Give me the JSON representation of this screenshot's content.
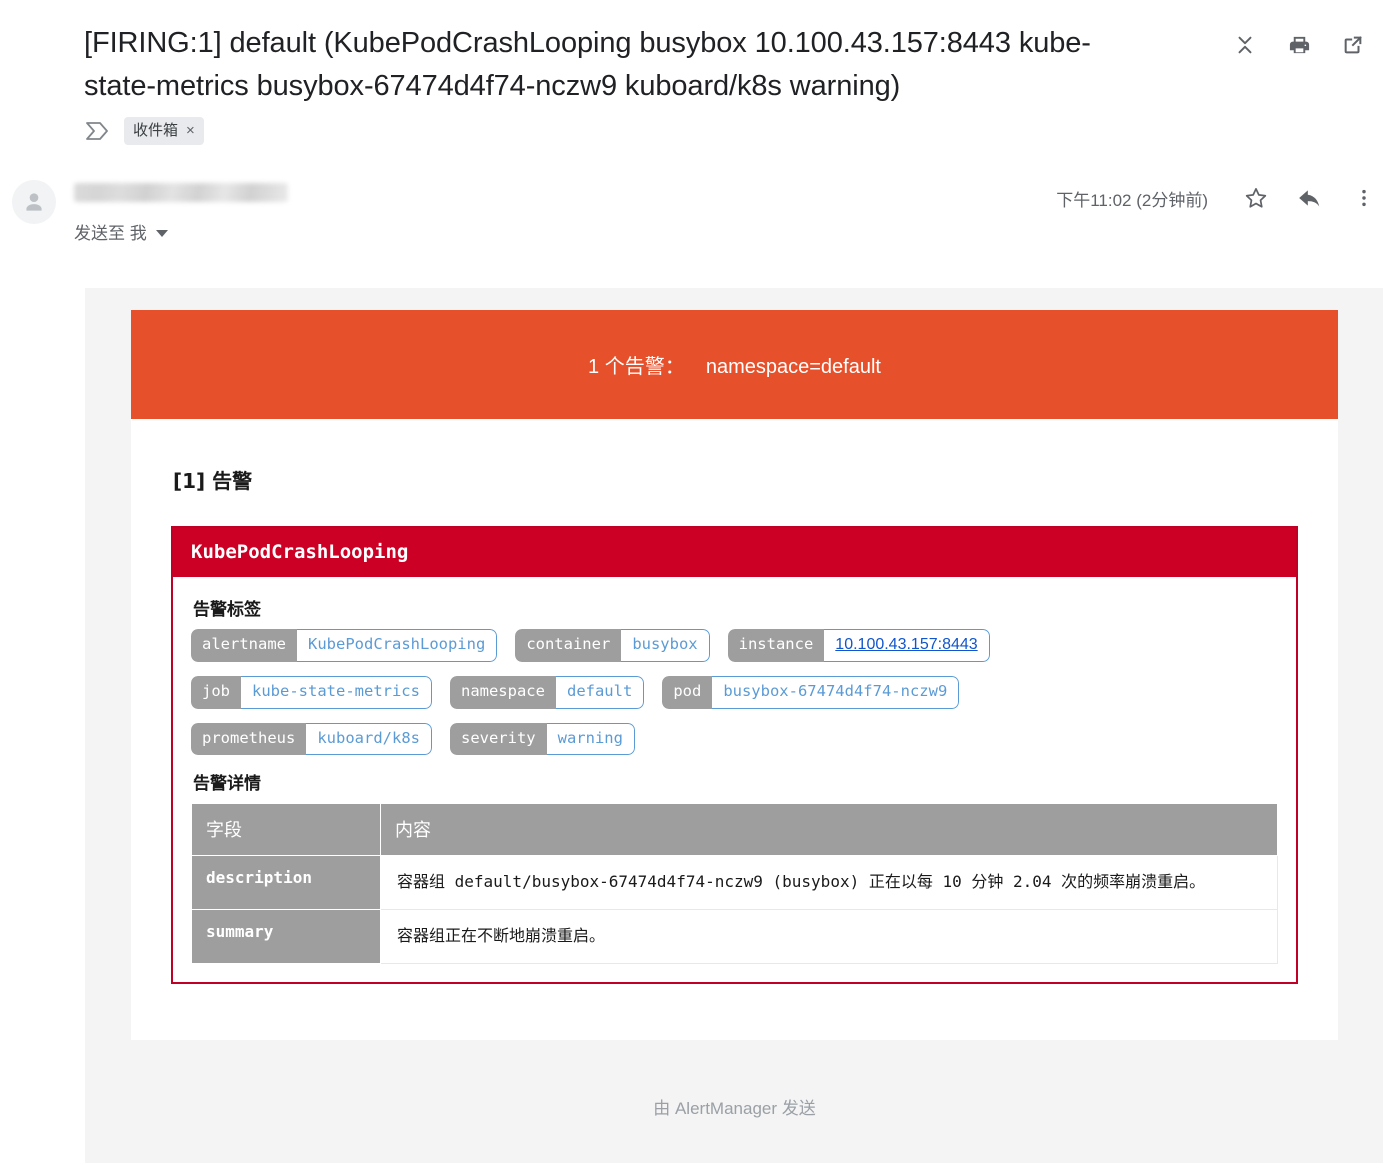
{
  "header": {
    "subject": "[FIRING:1] default (KubePodCrashLooping busybox 10.100.43.157:8443 kube-state-metrics busybox-67474d4f74-nczw9 kuboard/k8s warning)",
    "actions": [
      {
        "name": "collapse-all-icon",
        "label": "收起所有内容"
      },
      {
        "name": "print-icon",
        "label": "打印所有内容"
      },
      {
        "name": "open-in-new-window-icon",
        "label": "在新窗口中打开"
      }
    ],
    "labels": [
      {
        "text": "收件箱",
        "remove": "×"
      }
    ],
    "inbox_icon": "inbox-arrow-icon"
  },
  "message": {
    "sender_name": "",
    "sender_redacted": true,
    "recipient_line": "发送至 我",
    "timestamp": "下午11:02 (2分钟前)",
    "actions": [
      {
        "name": "star-icon",
        "label": "星标"
      },
      {
        "name": "reply-icon",
        "label": "回复"
      },
      {
        "name": "more-options-icon",
        "label": "更多"
      }
    ]
  },
  "mail": {
    "banner": {
      "count_label": "1 个告警：",
      "grouping": "namespace=default",
      "background": "#e6512c",
      "text_color": "#ffffff"
    },
    "group_title": "[1] 告警",
    "alert": {
      "name": "KubePodCrashLooping",
      "header_background": "#cc0024",
      "border_color": "#c00024",
      "labels_section_title": "告警标签",
      "labels": [
        {
          "key": "alertname",
          "value": "KubePodCrashLooping",
          "is_link": false
        },
        {
          "key": "container",
          "value": "busybox",
          "is_link": false
        },
        {
          "key": "instance",
          "value": "10.100.43.157:8443",
          "is_link": true
        },
        {
          "key": "job",
          "value": "kube-state-metrics",
          "is_link": false
        },
        {
          "key": "namespace",
          "value": "default",
          "is_link": false
        },
        {
          "key": "pod",
          "value": "busybox-67474d4f74-nczw9",
          "is_link": false
        },
        {
          "key": "prometheus",
          "value": "kuboard/k8s",
          "is_link": false
        },
        {
          "key": "severity",
          "value": "warning",
          "is_link": false
        }
      ],
      "details_section_title": "告警详情",
      "details_headers": [
        "字段",
        "内容"
      ],
      "details_rows": [
        {
          "field": "description",
          "content": "容器组 default/busybox-67474d4f74-nczw9 (busybox) 正在以每 10 分钟 2.04 次的频率崩溃重启。"
        },
        {
          "field": "summary",
          "content": "容器组正在不断地崩溃重启。"
        }
      ]
    },
    "footer": "由 AlertManager 发送"
  },
  "theme": {
    "page_background": "#ffffff",
    "body_background": "#f4f4f4",
    "pill_key_background": "#9e9e9e",
    "pill_value_color": "#5b9bd5",
    "link_color": "#1155cc",
    "muted_text": "#5f6368"
  }
}
